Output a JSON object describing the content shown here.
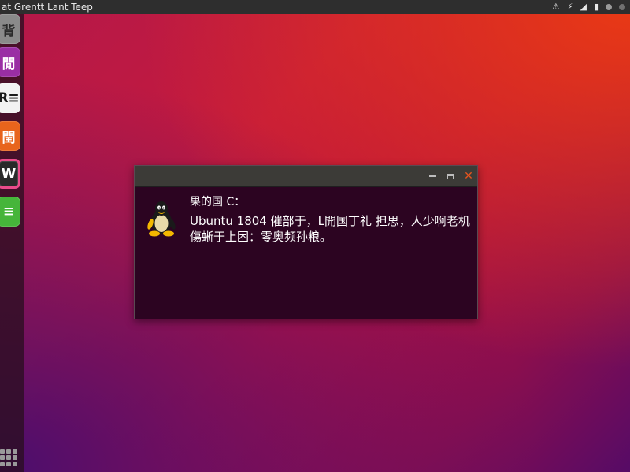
{
  "topbar": {
    "title": "at Grentt Lant Teep",
    "indicators": [
      "⚠",
      "⚡",
      "◢",
      "▮"
    ]
  },
  "dock": {
    "items": [
      {
        "label": "背",
        "icon": "files-icon"
      },
      {
        "label": "閒",
        "icon": "apps-icon"
      },
      {
        "label": "R≡",
        "icon": "docs-icon"
      },
      {
        "label": "閏",
        "icon": "store-icon"
      },
      {
        "label": "W",
        "icon": "music-icon"
      },
      {
        "label": "≡",
        "icon": "market-icon"
      }
    ]
  },
  "dialog": {
    "line1": "果的国 C：",
    "line2": "Ubuntu 1804 催部于，L開国丁礼 担思，人少啊老机",
    "line3": "傷蜥于上困：零奥频孙粮。"
  },
  "colors": {
    "topbar": "#2e2e2e",
    "window_body": "#2c0421",
    "window_titlebar": "#3c3b37",
    "close_button": "#e8541e",
    "wallpaper_orange": "#ea3a14",
    "wallpaper_purple": "#4a0d6e"
  }
}
